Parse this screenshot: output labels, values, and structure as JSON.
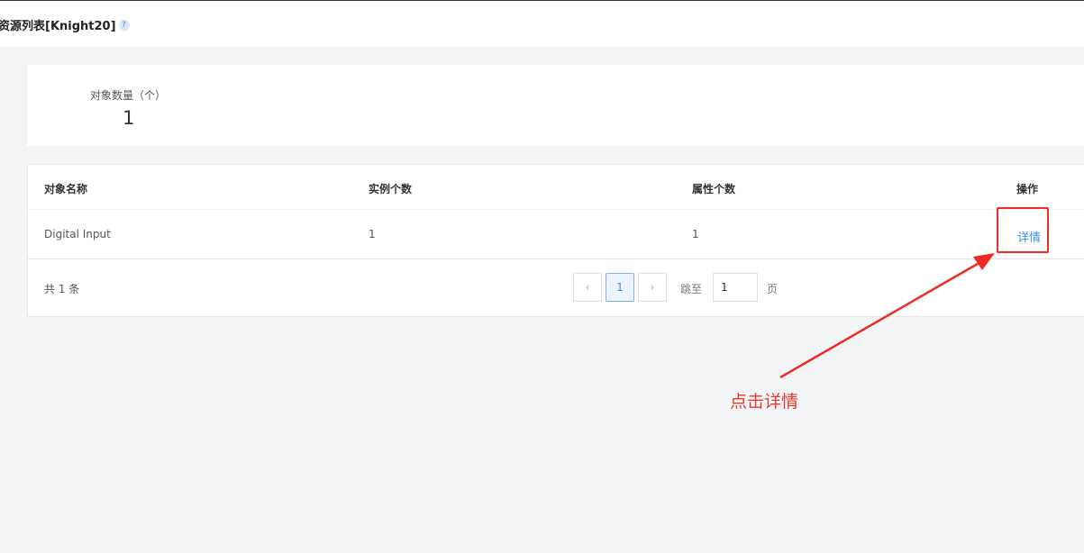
{
  "header": {
    "title": "资源列表[Knight20]",
    "help_icon": "?"
  },
  "stats": {
    "label": "对象数量（个）",
    "value": "1"
  },
  "table": {
    "columns": [
      "对象名称",
      "实例个数",
      "属性个数",
      "操作"
    ],
    "rows": [
      {
        "name": "Digital Input",
        "instances": "1",
        "attributes": "1",
        "action": "详情"
      }
    ]
  },
  "pagination": {
    "total_text": "共 1 条",
    "prev": "‹",
    "current_page": "1",
    "next": "›",
    "goto_label": "跳至",
    "goto_value": "1",
    "page_suffix": "页"
  },
  "annotation": {
    "text": "点击详情",
    "color": "#e53a2f"
  }
}
